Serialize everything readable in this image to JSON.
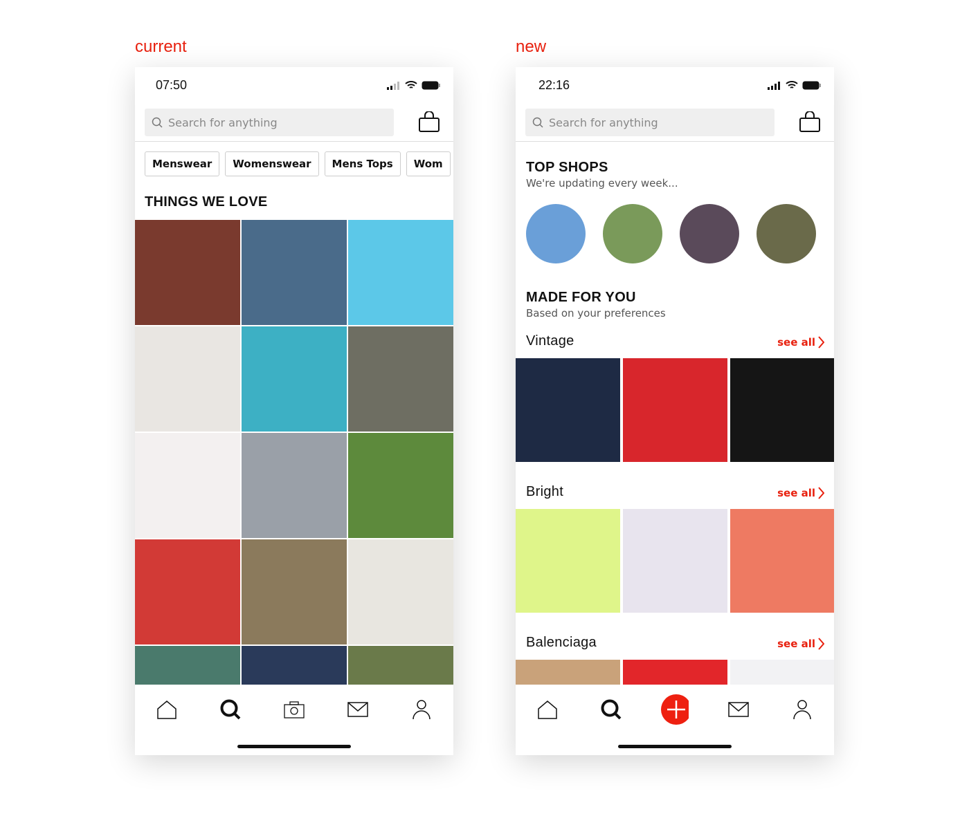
{
  "labels": {
    "current": "current",
    "new": "new"
  },
  "current": {
    "time": "07:50",
    "search_placeholder": "Search for anything",
    "chips": [
      "Menswear",
      "Womenswear",
      "Mens Tops",
      "Wom"
    ],
    "section_title": "THINGS WE LOVE",
    "tiles": [
      "#7a3a2e",
      "#4a6b8a",
      "#5cc8e8",
      "#e9e6e2",
      "#3db0c4",
      "#6e6e62",
      "#f3f0f0",
      "#9aa0a8",
      "#5d8a3c",
      "#d23a36",
      "#8b7a5c",
      "#e8e6e0",
      "#4a7a6c",
      "#2a3a5a",
      "#6a7a4a"
    ]
  },
  "new": {
    "time": "22:16",
    "search_placeholder": "Search for anything",
    "top_shops": {
      "title": "TOP SHOPS",
      "subtitle": "We're updating every week...",
      "avatars": [
        "#6a9fd8",
        "#7a9a5a",
        "#5a4a5a",
        "#6a6a4a"
      ]
    },
    "made_for_you": {
      "title": "MADE FOR YOU",
      "subtitle": "Based on your preferences"
    },
    "sections": [
      {
        "title": "Vintage",
        "see_all": "see all",
        "tiles": [
          "#1e2a44",
          "#d8262c",
          "#151515"
        ]
      },
      {
        "title": "Bright",
        "see_all": "see all",
        "tiles": [
          "#dff58a",
          "#e8e4ee",
          "#ee7a62"
        ]
      },
      {
        "title": "Balenciaga",
        "see_all": "see all",
        "tiles": [
          "#c9a27a",
          "#e2262a",
          "#f2f2f4"
        ]
      }
    ]
  },
  "accent": "#e8210f"
}
